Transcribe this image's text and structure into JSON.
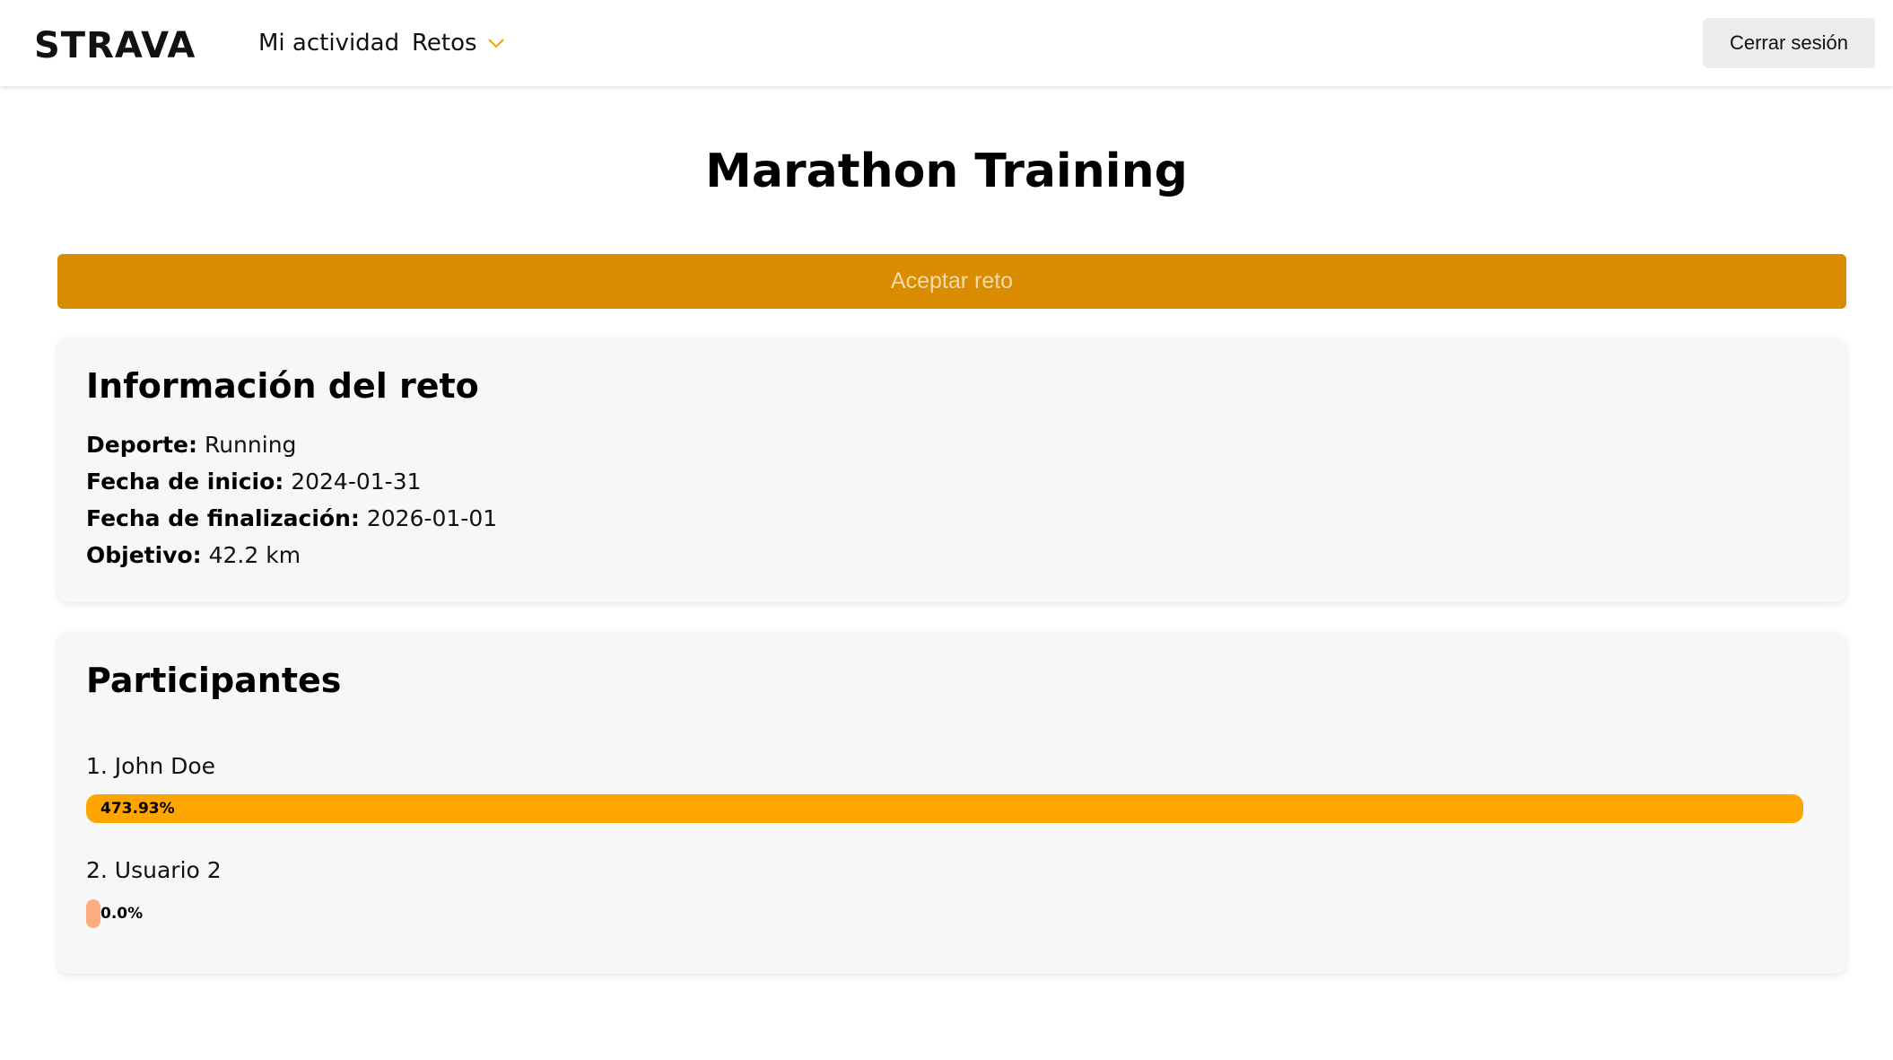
{
  "brand": {
    "logo_text": "STRAVA"
  },
  "nav": {
    "activity_label": "Mi actividad",
    "challenges_label": "Retos",
    "logout_label": "Cerrar sesión"
  },
  "challenge": {
    "title": "Marathon Training",
    "accept_label": "Aceptar reto"
  },
  "info": {
    "heading": "Información del reto",
    "sport_label": "Deporte:",
    "sport_value": "Running",
    "start_label": "Fecha de inicio:",
    "start_value": "2024-01-31",
    "end_label": "Fecha de finalización:",
    "end_value": "2026-01-01",
    "goal_label": "Objetivo:",
    "goal_value": "42.2 km"
  },
  "participants": {
    "heading": "Participantes",
    "list": [
      {
        "name": "1. John Doe",
        "progress_label": "473.93%",
        "progress": 473.93,
        "color": "#ffa500"
      },
      {
        "name": "2. Usuario 2",
        "progress_label": "0.0%",
        "progress": 0.0,
        "color": "#f9ad80"
      }
    ]
  },
  "colors": {
    "accent": "#d98c00",
    "accept_text": "#f6d9a8",
    "progress_full": "#ffa500",
    "progress_empty": "#f9ad80",
    "card_bg": "#f7f7f7"
  }
}
